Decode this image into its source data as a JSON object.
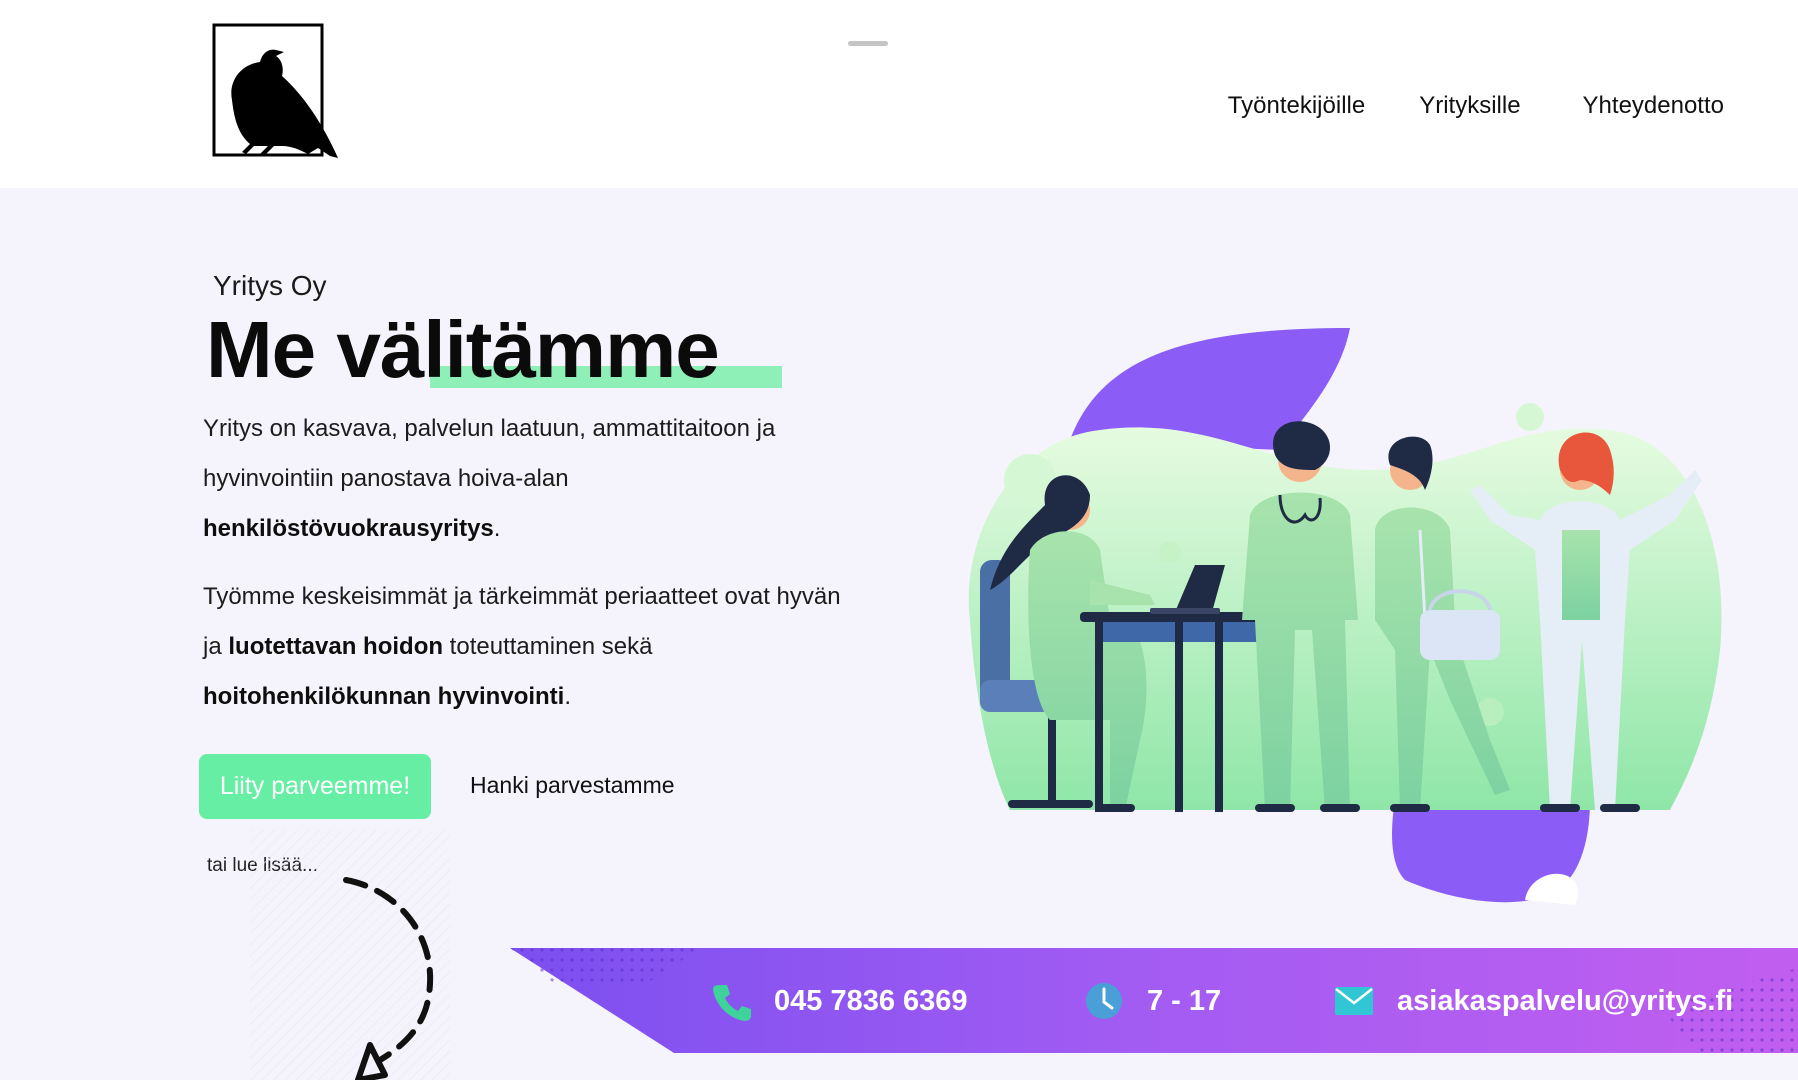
{
  "header": {
    "nav": [
      {
        "label": "Työntekijöille"
      },
      {
        "label": "Yrityksille"
      },
      {
        "label": "Yhteydenotto"
      }
    ]
  },
  "hero": {
    "company": "Yritys Oy",
    "title": "Me välitämme",
    "para1": {
      "text1": "Yritys on kasvava, palvelun laatuun, ammattitaitoon ja hyvinvointiin panostava hoiva-alan ",
      "bold1": "henkilöstövuokrausyritys",
      "text2": "."
    },
    "para2": {
      "text1": "Työmme keskeisimmät ja tärkeimmät periaatteet ovat hyvän ja ",
      "bold1": "luotettavan hoidon",
      "text2": " toteuttaminen sekä ",
      "bold2": "hoitohenkilökunnan hyvinvointi",
      "text3": "."
    },
    "primary_button": "Liity parveemme!",
    "secondary_button": "Hanki parvestamme",
    "read_more": "tai lue lisää..."
  },
  "contact": {
    "phone": "045 7836 6369",
    "hours": "7 - 17",
    "email": "asiakaspalvelu@yritys.fi"
  },
  "colors": {
    "accent_green": "#66eea4",
    "highlight_green": "#8ef0b6",
    "purple": "#8b5cf6",
    "banner_gradient_start": "#7c4ff0",
    "banner_gradient_end": "#c15ef0",
    "background": "#f5f3fb"
  },
  "icons": [
    "crow-logo",
    "phone-icon",
    "clock-icon",
    "mail-icon",
    "dashed-arrow"
  ]
}
